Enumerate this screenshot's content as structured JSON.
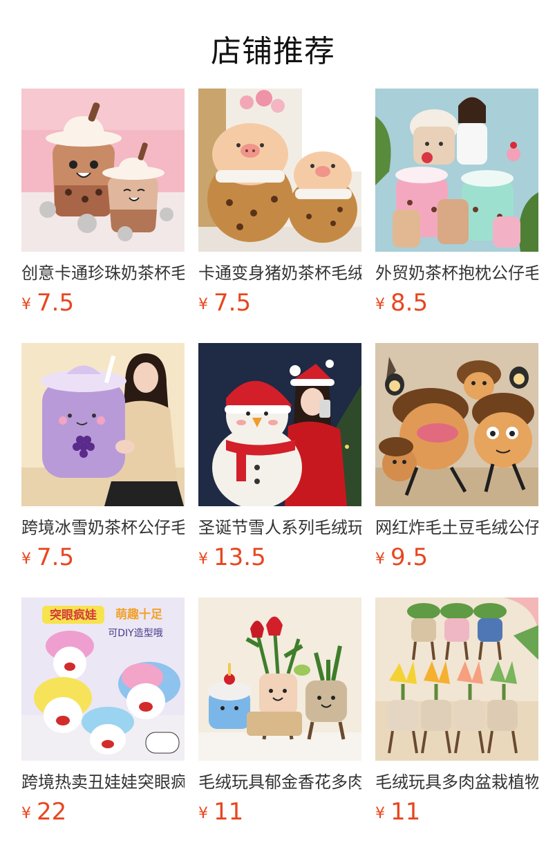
{
  "section": {
    "title": "店铺推荐"
  },
  "currency": "¥",
  "products": [
    {
      "name": "创意卡通珍珠奶茶杯毛绒公仔",
      "price": "7.5",
      "image": "boba-cup-plush-image"
    },
    {
      "name": "卡通变身猪奶茶杯毛绒公仔",
      "price": "7.5",
      "image": "pig-boba-plush-image"
    },
    {
      "name": "外贸奶茶杯抱枕公仔毛绒玩具",
      "price": "8.5",
      "image": "milk-tea-pillow-image"
    },
    {
      "name": "跨境冰雪奶茶杯公仔毛绒玩具",
      "price": "7.5",
      "image": "grape-tea-plush-image"
    },
    {
      "name": "圣诞节雪人系列毛绒玩具公仔",
      "price": "13.5",
      "image": "snowman-plush-image"
    },
    {
      "name": "网红炸毛土豆毛绒公仔玩具",
      "price": "9.5",
      "image": "potato-plush-image"
    },
    {
      "name": "跨境热卖丑娃娃突眼疯娃毛绒",
      "price": "22",
      "image": "crazy-doll-image"
    },
    {
      "name": "毛绒玩具郁金香花多肉盆栽",
      "price": "11",
      "image": "tulip-pot-plush-image"
    },
    {
      "name": "毛绒玩具多肉盆栽植物公仔",
      "price": "11",
      "image": "succulent-plush-image"
    }
  ],
  "image_text": {
    "crazy_doll_banner": "突眼疯娃",
    "crazy_doll_slogan": "萌趣十足",
    "crazy_doll_sub": "可DIY造型哦"
  },
  "colors": {
    "price": "#e8461e",
    "title": "#111111",
    "text": "#333333"
  }
}
